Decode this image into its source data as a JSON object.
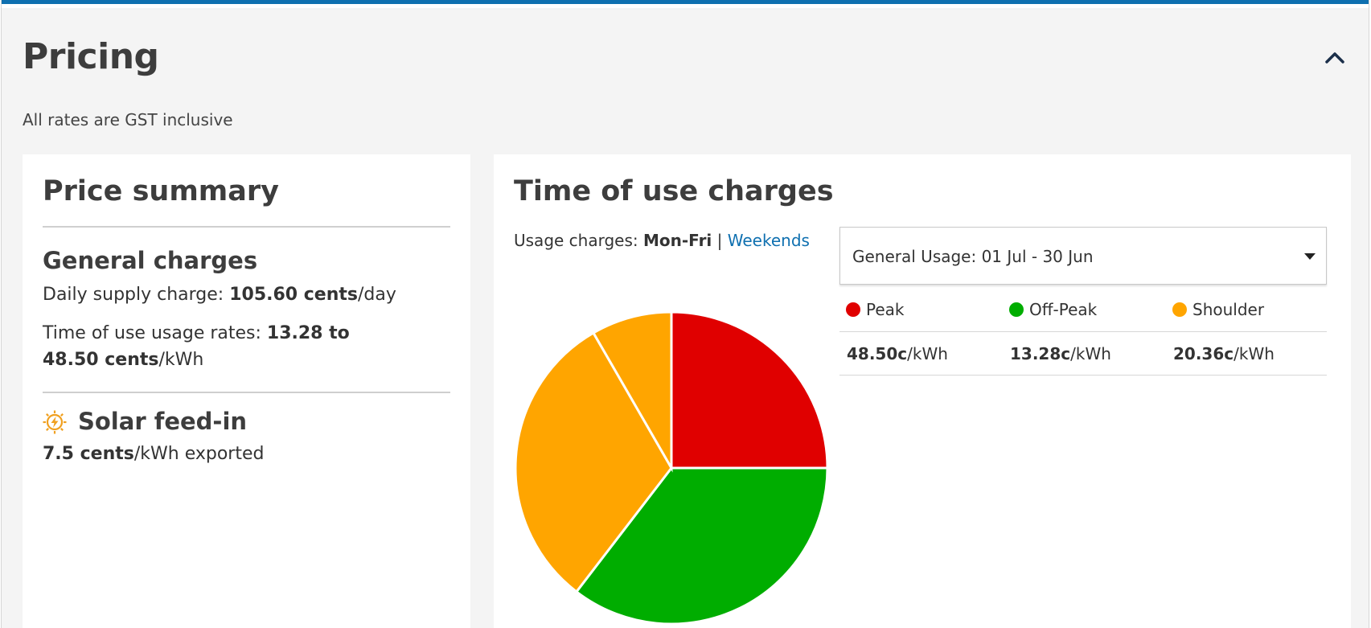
{
  "section": {
    "title": "Pricing",
    "subtitle": "All rates are GST inclusive",
    "collapse_icon": "chevron-up-icon"
  },
  "price_summary": {
    "title": "Price summary",
    "general": {
      "heading": "General charges",
      "daily_label": "Daily supply charge: ",
      "daily_value": "105.60 cents",
      "daily_unit": "/day",
      "tou_label": "Time of use usage rates: ",
      "tou_value": "13.28 to 48.50 cents",
      "tou_unit": "/kWh"
    },
    "solar": {
      "icon": "solar-sun-icon",
      "heading": "Solar feed-in",
      "value": "7.5 cents",
      "unit": "/kWh exported"
    }
  },
  "tou": {
    "title": "Time of use charges",
    "usage_label": "Usage charges: ",
    "active_tab": "Mon-Fri",
    "separator": "|",
    "other_tab": "Weekends",
    "select": {
      "value": "General Usage: 01 Jul - 30 Jun",
      "icon": "caret-down-icon"
    },
    "legend": [
      {
        "label": "Peak",
        "color": "#e00000",
        "rate": "48.50c",
        "unit": "/kWh"
      },
      {
        "label": "Off-Peak",
        "color": "#00ad00",
        "rate": "13.28c",
        "unit": "/kWh"
      },
      {
        "label": "Shoulder",
        "color": "#ffa500",
        "rate": "20.36c",
        "unit": "/kWh"
      }
    ]
  },
  "chart_data": {
    "type": "pie",
    "slices": [
      {
        "name": "Peak",
        "value": 6,
        "color": "#e00000"
      },
      {
        "name": "Off-Peak",
        "value": 8.5,
        "color": "#00ad00"
      },
      {
        "name": "Shoulder",
        "value": 7.5,
        "color": "#ffa500"
      },
      {
        "name": "Shoulder",
        "value": 2,
        "color": "#ffa500"
      }
    ]
  }
}
